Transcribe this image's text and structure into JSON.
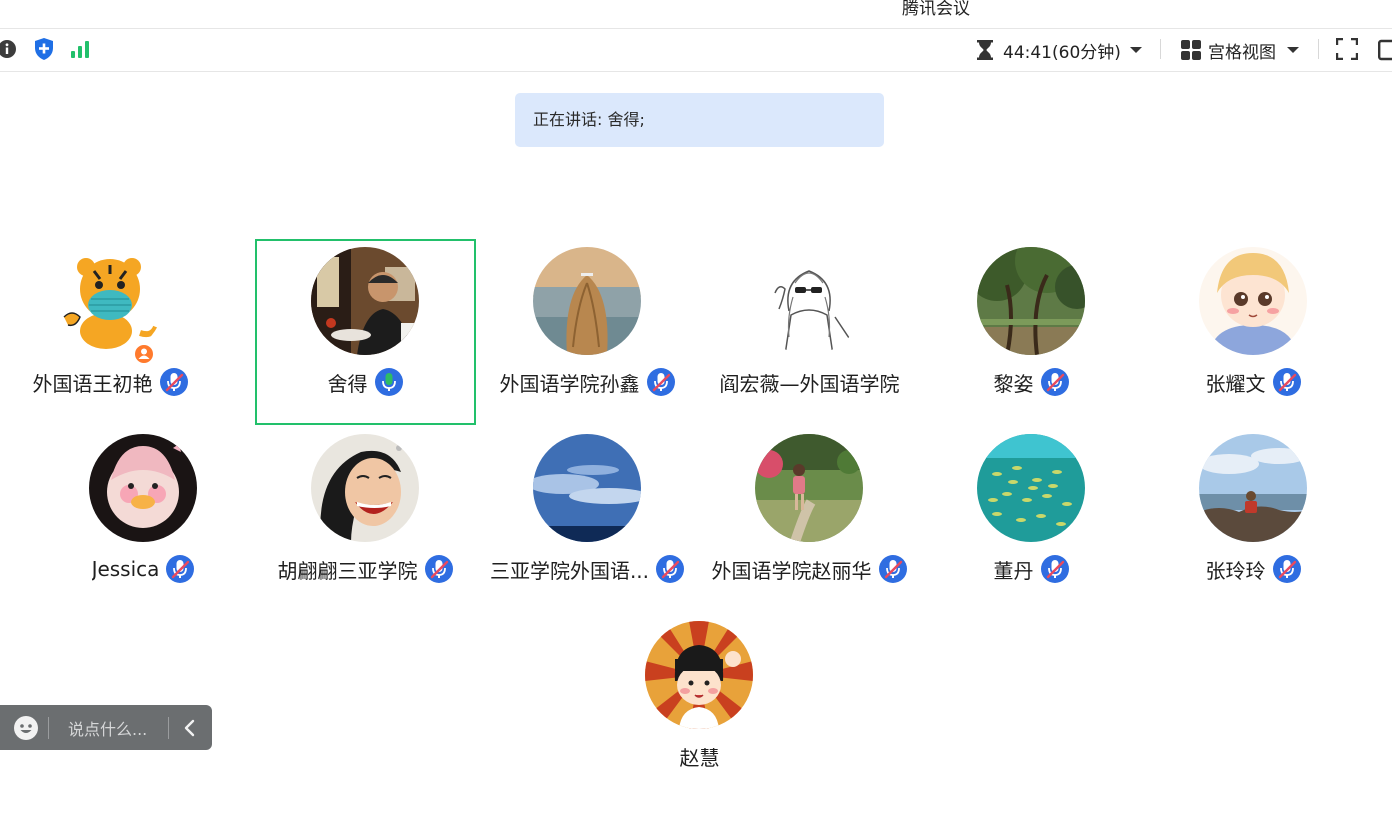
{
  "window": {
    "title": "腾讯会议"
  },
  "toolbar": {
    "left_icons": [
      "info-icon",
      "shield-icon",
      "signal-icon"
    ],
    "timer": "44:41(60分钟)",
    "view_mode": "宫格视图"
  },
  "speaking_banner": "正在讲话: 舍得;",
  "colors": {
    "active_border": "#22c06b",
    "mic_blue": "#2f6de1",
    "mic_speaking": "#2ebd63",
    "banner_bg": "#dbe8fc"
  },
  "participants": [
    {
      "name": "外国语王初艳",
      "mic": "muted",
      "avatar": "tiger-mask",
      "host": true
    },
    {
      "name": "舍得",
      "mic": "speaking",
      "avatar": "man-photo",
      "active": true
    },
    {
      "name": "外国语学院孙鑫",
      "mic": "muted",
      "avatar": "beach-hair"
    },
    {
      "name": "阎宏薇—外国语学院",
      "mic": "none",
      "avatar": "sketch-girl"
    },
    {
      "name": "黎姿",
      "mic": "muted",
      "avatar": "trees"
    },
    {
      "name": "张耀文",
      "mic": "muted",
      "avatar": "anime-blonde"
    },
    {
      "name": "Jessica",
      "mic": "muted",
      "avatar": "plush-duck"
    },
    {
      "name": "胡翩翩三亚学院",
      "mic": "muted",
      "avatar": "laughing-woman"
    },
    {
      "name": "三亚学院外国语...",
      "mic": "muted",
      "avatar": "sky-sea"
    },
    {
      "name": "外国语学院赵丽华",
      "mic": "muted",
      "avatar": "garden-woman"
    },
    {
      "name": "董丹",
      "mic": "muted",
      "avatar": "fish-school"
    },
    {
      "name": "张玲玲",
      "mic": "muted",
      "avatar": "rocky-shore"
    },
    {
      "name": "赵慧",
      "mic": "none",
      "avatar": "cartoon-girl"
    }
  ],
  "chat": {
    "placeholder": "说点什么..."
  }
}
